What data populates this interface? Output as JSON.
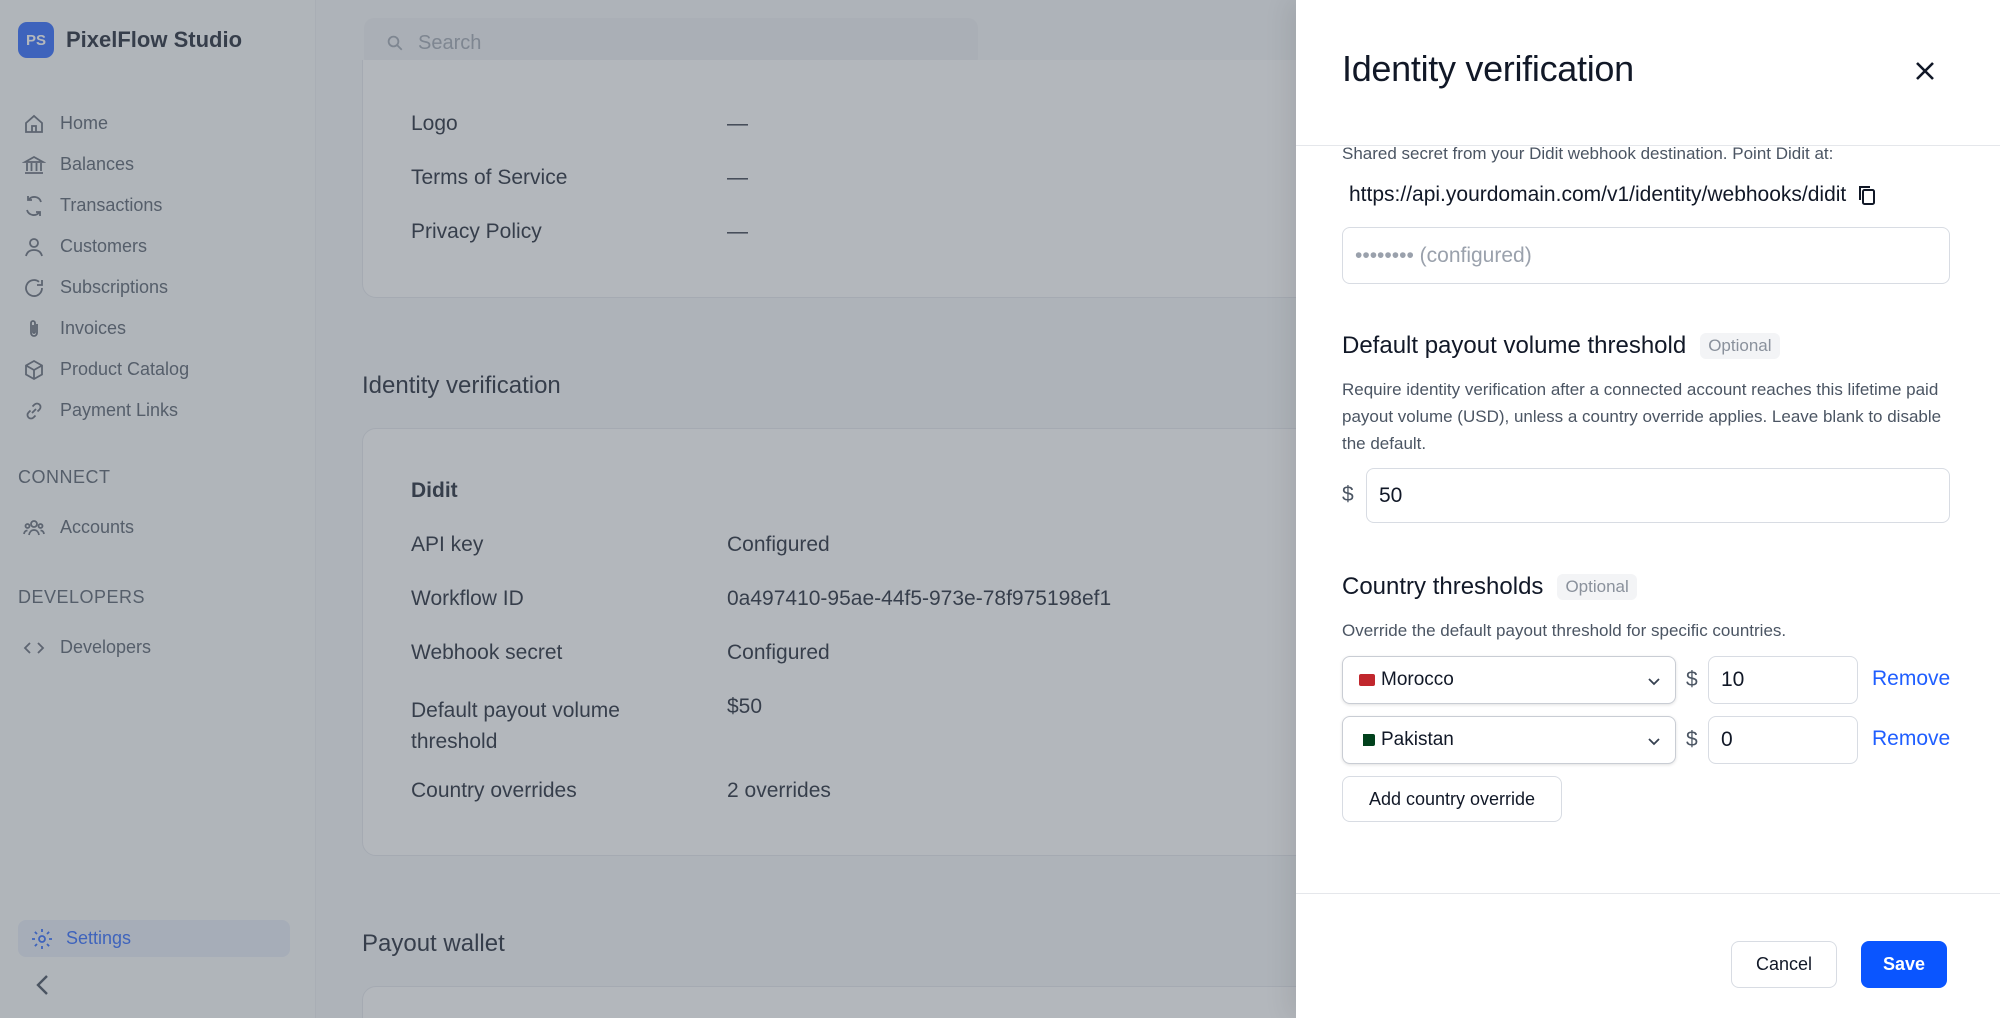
{
  "brand": {
    "initials": "PS",
    "name": "PixelFlow Studio"
  },
  "sidebar": {
    "items": [
      {
        "label": "Home",
        "icon": "home-icon"
      },
      {
        "label": "Balances",
        "icon": "bank-icon"
      },
      {
        "label": "Transactions",
        "icon": "refresh-icon"
      },
      {
        "label": "Customers",
        "icon": "user-icon"
      },
      {
        "label": "Subscriptions",
        "icon": "rotate-icon"
      },
      {
        "label": "Invoices",
        "icon": "paperclip-icon"
      },
      {
        "label": "Product Catalog",
        "icon": "box-icon"
      },
      {
        "label": "Payment Links",
        "icon": "link-icon"
      }
    ],
    "connect_label": "CONNECT",
    "connect_items": [
      {
        "label": "Accounts",
        "icon": "users-icon"
      }
    ],
    "developers_label": "DEVELOPERS",
    "developer_items": [
      {
        "label": "Developers",
        "icon": "code-icon"
      }
    ],
    "settings_label": "Settings"
  },
  "search": {
    "placeholder": "Search"
  },
  "branding_card": {
    "rows": [
      {
        "label": "Logo",
        "value": "—"
      },
      {
        "label": "Terms of Service",
        "value": "—"
      },
      {
        "label": "Privacy Policy",
        "value": "—"
      }
    ]
  },
  "identity_section": {
    "title": "Identity verification",
    "provider": "Didit",
    "rows": [
      {
        "label": "API key",
        "value": "Configured"
      },
      {
        "label": "Workflow ID",
        "value": "0a497410-95ae-44f5-973e-78f975198ef1"
      },
      {
        "label": "Webhook secret",
        "value": "Configured"
      },
      {
        "label": "Default payout volume threshold",
        "value": "$50"
      },
      {
        "label": "Country overrides",
        "value": "2 overrides"
      }
    ]
  },
  "payout_section": {
    "title": "Payout wallet"
  },
  "drawer": {
    "title": "Identity verification",
    "webhook_help": "Shared secret from your Didit webhook destination. Point Didit at:",
    "webhook_url": "https://api.yourdomain.com/v1/identity/webhooks/didit",
    "secret_placeholder": "•••••••• (configured)",
    "default_threshold": {
      "title": "Default payout volume threshold",
      "tag": "Optional",
      "help": "Require identity verification after a connected account reaches this lifetime paid payout volume (USD), unless a country override applies. Leave blank to disable the default.",
      "currency": "$",
      "value": "50"
    },
    "country_thresholds": {
      "title": "Country thresholds",
      "tag": "Optional",
      "help": "Override the default payout threshold for specific countries.",
      "overrides": [
        {
          "country": "Morocco",
          "currency": "$",
          "value": "10",
          "remove_label": "Remove"
        },
        {
          "country": "Pakistan",
          "currency": "$",
          "value": "0",
          "remove_label": "Remove"
        }
      ],
      "add_label": "Add country override"
    },
    "cancel_label": "Cancel",
    "save_label": "Save"
  },
  "colors": {
    "accent": "#1f5eff",
    "primary_button": "#0a55ff",
    "overlay": "#616873"
  }
}
